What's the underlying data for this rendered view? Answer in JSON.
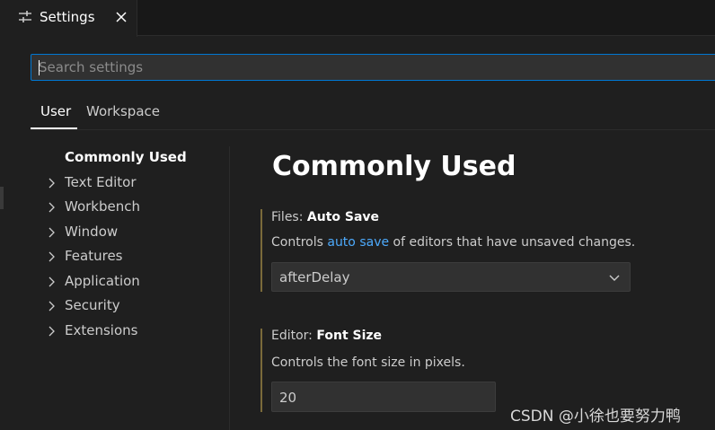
{
  "editor_tab": {
    "title": "Settings",
    "icon": "settings-sliders-icon",
    "close_icon": "close-icon"
  },
  "search": {
    "placeholder": "Search settings",
    "value": ""
  },
  "scope_tabs": [
    {
      "label": "User",
      "active": true
    },
    {
      "label": "Workspace",
      "active": false
    }
  ],
  "toc": [
    {
      "label": "Commonly Used",
      "active": true,
      "expandable": false
    },
    {
      "label": "Text Editor",
      "expandable": true
    },
    {
      "label": "Workbench",
      "expandable": true
    },
    {
      "label": "Window",
      "expandable": true
    },
    {
      "label": "Features",
      "expandable": true
    },
    {
      "label": "Application",
      "expandable": true
    },
    {
      "label": "Security",
      "expandable": true
    },
    {
      "label": "Extensions",
      "expandable": true
    }
  ],
  "content": {
    "section_title": "Commonly Used",
    "settings": [
      {
        "category": "Files: ",
        "name": "Auto Save",
        "desc_pre": "Controls ",
        "desc_link": "auto save",
        "desc_post": " of editors that have unsaved changes.",
        "value": "afterDelay"
      },
      {
        "category": "Editor: ",
        "name": "Font Size",
        "desc": "Controls the font size in pixels.",
        "value": "20"
      }
    ]
  },
  "watermark": "CSDN @小徐也要努力鸭",
  "colors": {
    "accent": "#0078d4",
    "link": "#4daafc",
    "background": "#1f1f1f",
    "modified_bar": "#7a6a3a"
  }
}
